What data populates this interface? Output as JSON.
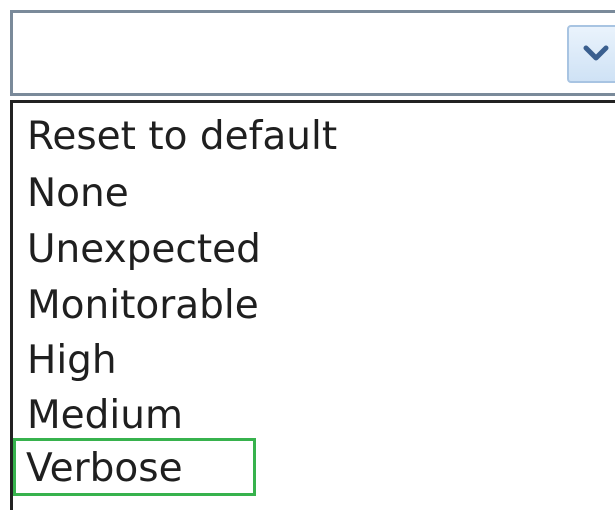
{
  "combo": {
    "selected_value": "",
    "button_icon": "chevron-down-icon"
  },
  "dropdown": {
    "options": [
      {
        "label": "Reset to default"
      },
      {
        "label": "None"
      },
      {
        "label": "Unexpected"
      },
      {
        "label": "Monitorable"
      },
      {
        "label": "High"
      },
      {
        "label": "Medium"
      },
      {
        "label": "Verbose",
        "selected": true
      }
    ],
    "highlight_color": "#37b24d"
  }
}
